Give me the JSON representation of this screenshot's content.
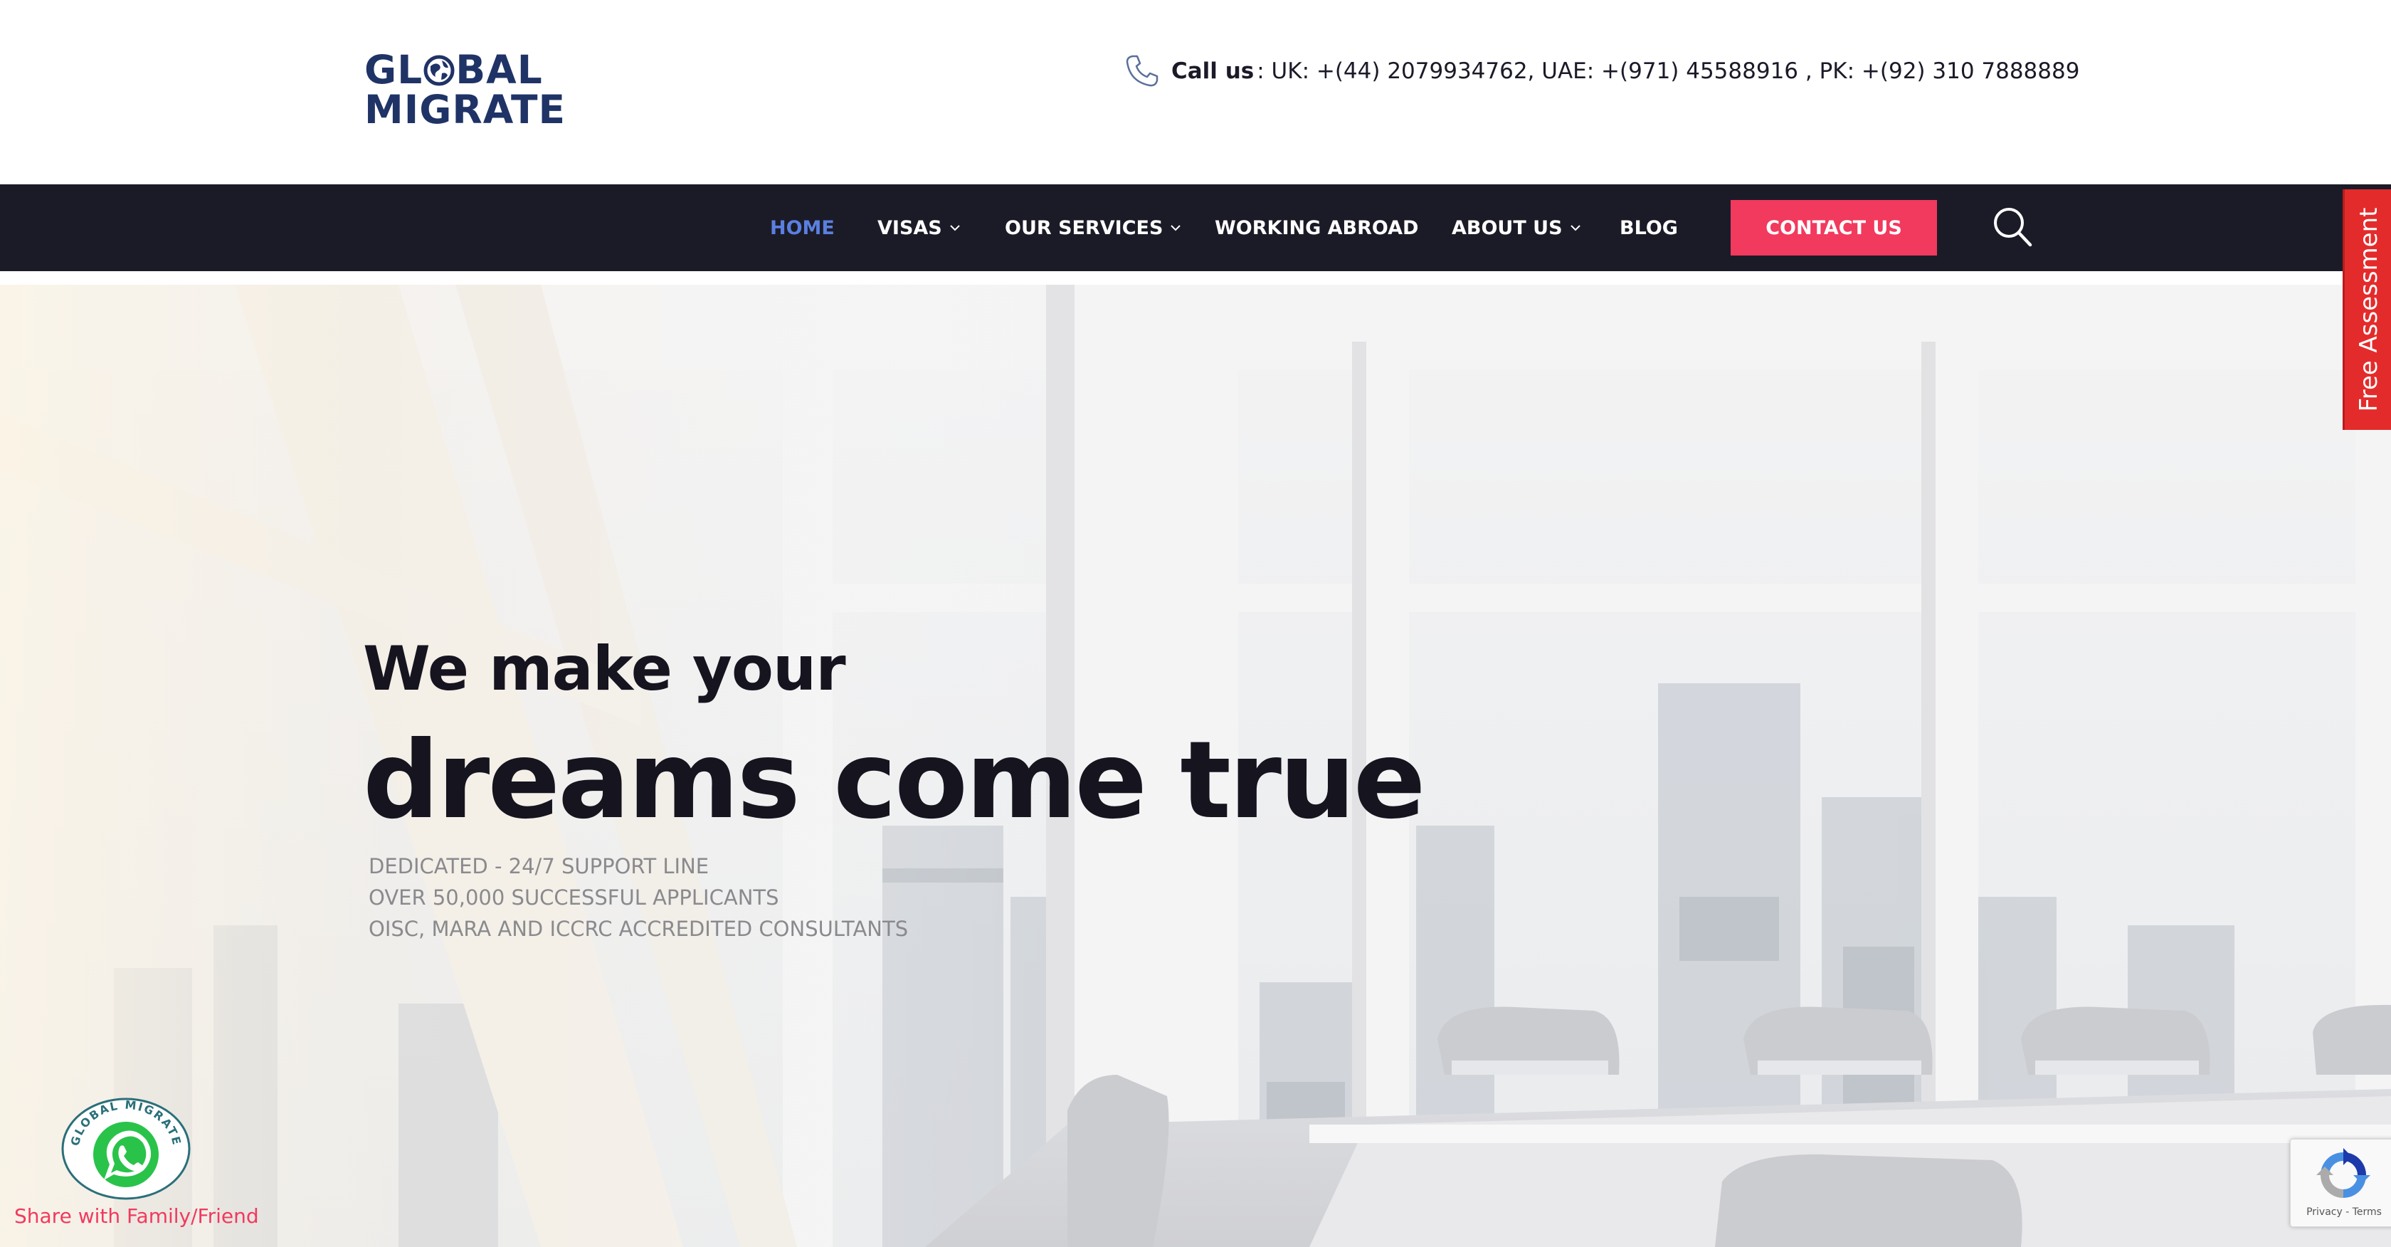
{
  "brand": {
    "logo_line1_start": "GL",
    "logo_line1_end": "BAL",
    "logo_line2": "MIGRATE",
    "primary_color": "#1f3366"
  },
  "contact": {
    "icon": "phone-icon",
    "call_label": "Call us",
    "numbers": ": UK: +(44) 2079934762, UAE: +(971) 45588916 , PK: +(92) 310 7888889"
  },
  "nav": {
    "items": [
      {
        "label": "HOME",
        "active": true
      },
      {
        "label": "VISAS",
        "has_dropdown": true
      },
      {
        "label": "OUR SERVICES",
        "has_dropdown": true
      },
      {
        "label": "WORKING ABROAD"
      },
      {
        "label": "ABOUT US",
        "has_dropdown": true
      },
      {
        "label": "BLOG"
      }
    ],
    "contact_button": "CONTACT US",
    "search_icon": "search-icon",
    "bar_color": "#1b1b28",
    "active_color": "#5b7fe0",
    "button_color": "#f2395e"
  },
  "hero": {
    "title_small": "We make your",
    "title_large": "dreams come true",
    "features": [
      "DEDICATED - 24/7 SUPPORT LINE",
      "OVER 50,000 SUCCESSFUL APPLICANTS",
      "OISC, MARA AND ICCRC ACCREDITED CONSULTANTS"
    ]
  },
  "side_tab": {
    "label": "Free Assessment",
    "color": "#e42b2b"
  },
  "whatsapp": {
    "badge_text": "GLOBAL MIGRATE",
    "share_text": "Share with Family/Friend",
    "icon": "whatsapp-icon"
  },
  "recaptcha": {
    "links": "Privacy - Terms",
    "icon": "recaptcha-icon"
  }
}
